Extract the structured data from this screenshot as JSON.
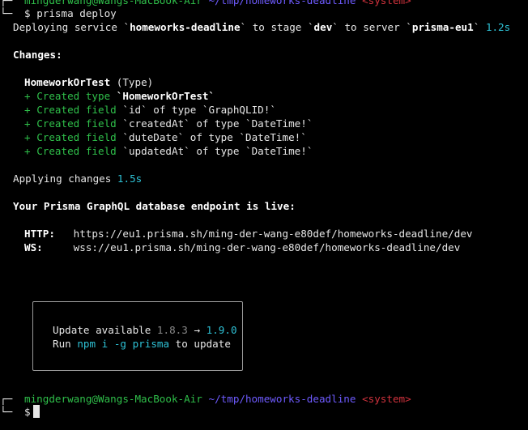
{
  "prompt_top": {
    "user_host": "mingderwang@Wangs-MacBook-Air",
    "path": "~/tmp/homeworks-deadline",
    "tag": "<system>"
  },
  "command": {
    "symbol": "$",
    "text": "prisma deploy"
  },
  "deploy_line": {
    "prefix": "Deploying service `",
    "service": "homeworks-deadline",
    "mid1": "` to stage `",
    "stage": "dev",
    "mid2": "` to server `",
    "server": "prisma-eu1",
    "suffix": "`",
    "time": "1.2s"
  },
  "changes_header": "Changes:",
  "type_header": {
    "name": "HomeworkOrTest",
    "kind": "(Type)"
  },
  "changes": [
    {
      "plus": "+",
      "action": "Created type",
      "detail": "`HomeworkOrTest`"
    },
    {
      "plus": "+",
      "action": "Created field",
      "detail": "`id` of type `GraphQLID!`"
    },
    {
      "plus": "+",
      "action": "Created field",
      "detail": "`createdAt` of type `DateTime!`"
    },
    {
      "plus": "+",
      "action": "Created field",
      "detail": "`duteDate` of type `DateTime!`"
    },
    {
      "plus": "+",
      "action": "Created field",
      "detail": "`updatedAt` of type `DateTime!`"
    }
  ],
  "applying": {
    "label": "Applying changes",
    "time": "1.5s"
  },
  "endpoint_header": "Your Prisma GraphQL database endpoint is live:",
  "endpoints": {
    "http_label": "HTTP:",
    "http_url": "https://eu1.prisma.sh/ming-der-wang-e80def/homeworks-deadline/dev",
    "ws_label": "WS:",
    "ws_url": "wss://eu1.prisma.sh/ming-der-wang-e80def/homeworks-deadline/dev"
  },
  "update_box": {
    "label": "Update available",
    "old_version": "1.8.3",
    "arrow": "→",
    "new_version": "1.9.0",
    "run_prefix": "Run",
    "command": "npm i -g prisma",
    "run_suffix": "to update"
  },
  "prompt_bottom": {
    "user_host": "mingderwang@Wangs-MacBook-Air",
    "path": "~/tmp/homeworks-deadline",
    "tag": "<system>",
    "symbol": "$"
  },
  "colors": {
    "background": "#000000",
    "text": "#e6e6e6",
    "cyan": "#2ec2d6",
    "green": "#2fbf4a",
    "purple": "#6e5bff",
    "red": "#d0323d"
  }
}
